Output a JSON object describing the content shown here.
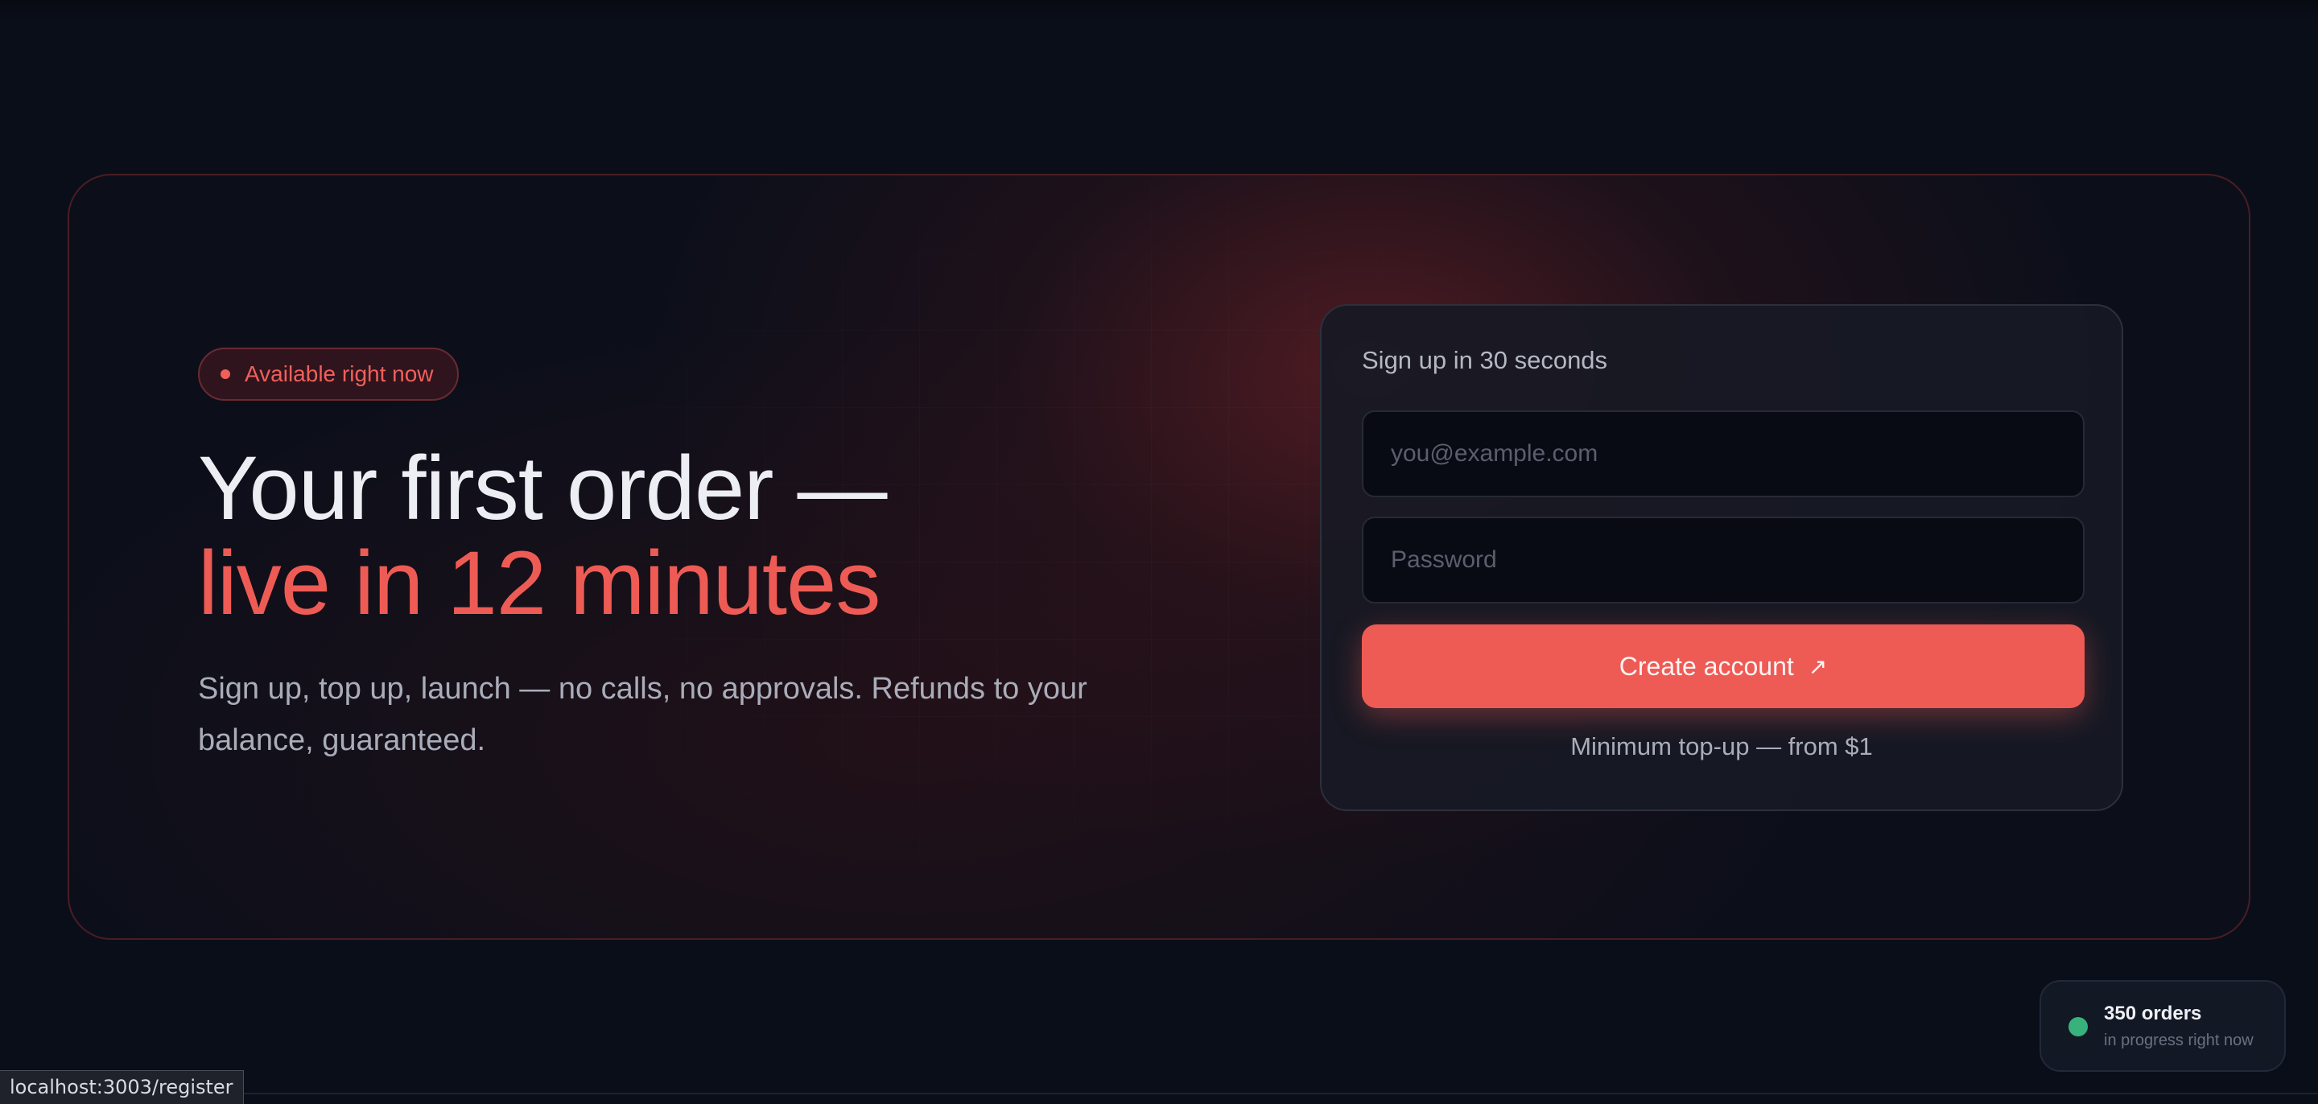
{
  "hero": {
    "badge": "Available right now",
    "headline_line1": "Your first order —",
    "headline_line2": "live in 12 minutes",
    "subtext": "Sign up, top up, launch — no calls, no approvals. Refunds to your balance, guaranteed."
  },
  "signup": {
    "title": "Sign up in 30 seconds",
    "email_placeholder": "you@example.com",
    "password_placeholder": "Password",
    "button_label": "Create account",
    "button_icon": "arrow-up-right-icon",
    "note": "Minimum top-up — from $1"
  },
  "orders_widget": {
    "count": "350 orders",
    "subtitle": "in progress right now"
  },
  "status_bar": {
    "url": "localhost:3003/register"
  },
  "colors": {
    "accent": "#ee5b55",
    "background": "#0a0e19",
    "success": "#37b27c"
  }
}
